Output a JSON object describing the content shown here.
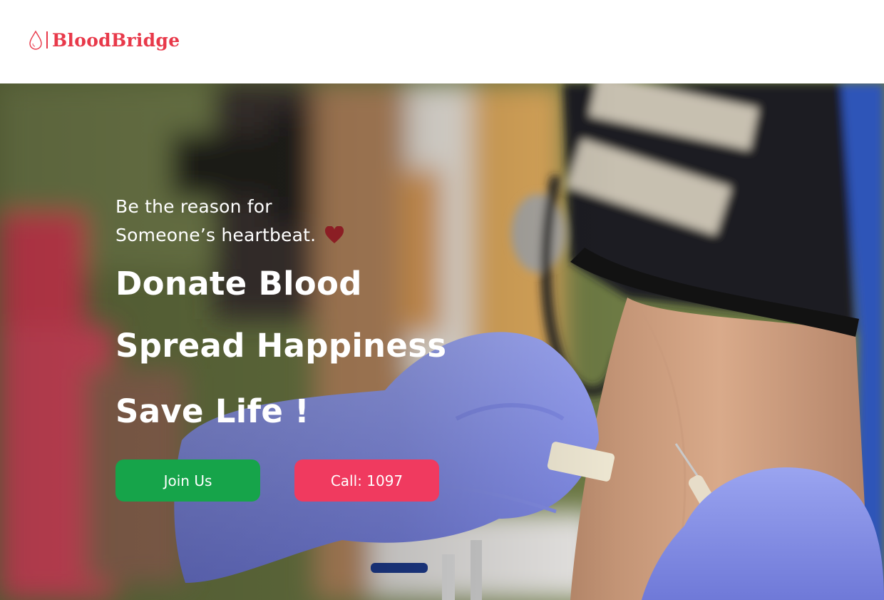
{
  "brand": {
    "name": "BloodBridge",
    "separator": "|",
    "icon": "blood-drop-icon",
    "color": "#e8394a"
  },
  "hero": {
    "tagline_line1": "Be the reason for",
    "tagline_line2": "Someone’s heartbeat.",
    "tagline_icon": "heart-icon",
    "heading_1": "Donate Blood",
    "heading_2": "Spread Happiness",
    "heading_3": "Save Life !",
    "join_button": "Join Us",
    "call_button": "Call: 1097",
    "colors": {
      "join": "#16a44a",
      "call": "#f03a5f",
      "heart": "#8b1e24"
    }
  }
}
